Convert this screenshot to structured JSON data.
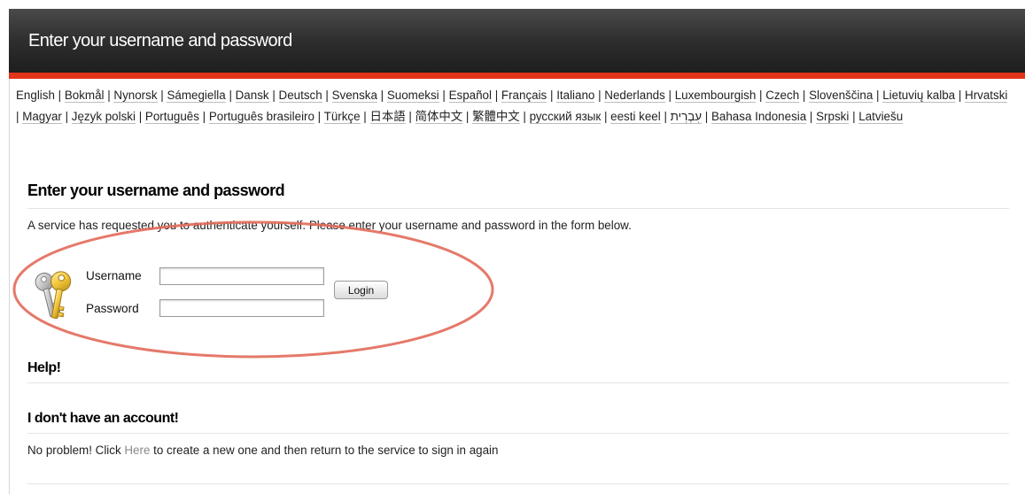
{
  "header": {
    "title": "Enter your username and password"
  },
  "languages": [
    "English",
    "Bokmål",
    "Nynorsk",
    "Sámegiella",
    "Dansk",
    "Deutsch",
    "Svenska",
    "Suomeksi",
    "Español",
    "Français",
    "Italiano",
    "Nederlands",
    "Luxembourgish",
    "Czech",
    "Slovenščina",
    "Lietuvių kalba",
    "Hrvatski",
    "Magyar",
    "Język polski",
    "Português",
    "Português brasileiro",
    "Türkçe",
    "日本語",
    "简体中文",
    "繁體中文",
    "русский язык",
    "eesti keel",
    "עִבְרִית",
    "Bahasa Indonesia",
    "Srpski",
    "Latviešu"
  ],
  "current_language": "English",
  "main": {
    "heading": "Enter your username and password",
    "intro": "A service has requested you to authenticate yourself. Please enter your username and password in the form below."
  },
  "form": {
    "username_label": "Username",
    "username_value": "",
    "password_label": "Password",
    "password_value": "",
    "login_label": "Login"
  },
  "help": {
    "heading": "Help!",
    "no_account_heading": "I don't have an account!",
    "text_before": "No problem! Click ",
    "link_label": "Here",
    "text_after": " to create a new one and then return to the service to sign in again"
  },
  "colors": {
    "accent": "#e23418",
    "header_dark": "#2e2e2e",
    "highlight_ring": "#e26a5a"
  },
  "icons": {
    "login_icon": "keys-icon"
  }
}
